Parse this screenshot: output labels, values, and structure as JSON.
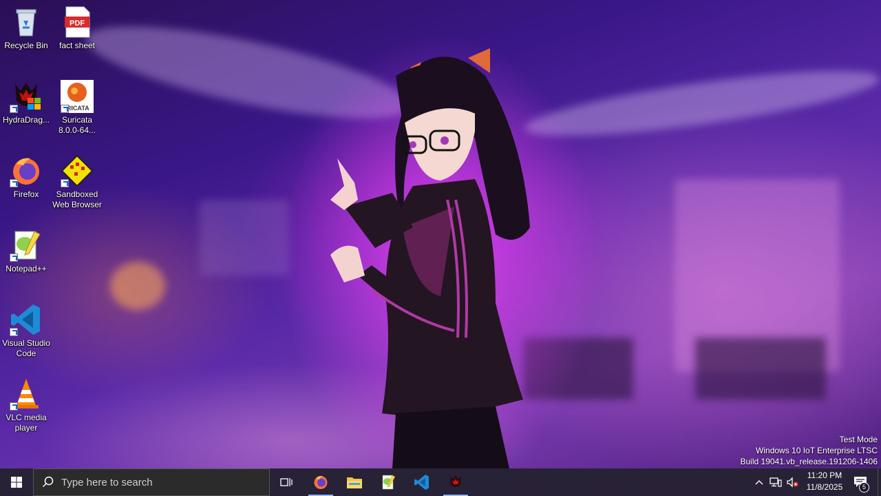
{
  "desktop": {
    "icons": [
      {
        "label": "Recycle Bin",
        "icon": "recycle-bin-icon"
      },
      {
        "label": "fact sheet",
        "icon": "pdf-icon",
        "badge": "PDF"
      },
      {
        "label": "HydraDrag...",
        "icon": "hydradragon-icon"
      },
      {
        "label": "Suricata 8.0.0-64...",
        "icon": "suricata-icon",
        "badge": "IRICATA"
      },
      {
        "label": "Firefox",
        "icon": "firefox-icon"
      },
      {
        "label": "Sandboxed Web Browser",
        "icon": "sandboxed-browser-icon"
      },
      {
        "label": "Notepad++",
        "icon": "notepad-plus-plus-icon"
      },
      {
        "label": "Visual Studio Code",
        "icon": "vscode-icon"
      },
      {
        "label": "VLC media player",
        "icon": "vlc-icon"
      }
    ]
  },
  "watermark": {
    "line1": "Test Mode",
    "line2": "Windows 10 IoT Enterprise LTSC",
    "line3": "Build 19041.vb_release.191206-1406"
  },
  "taskbar": {
    "start_icon": "windows-start-icon",
    "search_placeholder": "Type here to search",
    "task_view_icon": "task-view-icon",
    "pinned": [
      "firefox-icon",
      "file-explorer-icon",
      "notepad-plus-plus-icon",
      "vscode-icon",
      "hydradragon-icon"
    ],
    "tray": {
      "chevron_icon": "chevron-up-icon",
      "network_icon": "network-icon",
      "volume_icon": "volume-muted-icon",
      "time": "11:20 PM",
      "date": "11/8/2025",
      "notifications_count": "5"
    }
  },
  "colors": {
    "taskbar_bg": "#1a1428",
    "accent": "#8fb8ff"
  }
}
